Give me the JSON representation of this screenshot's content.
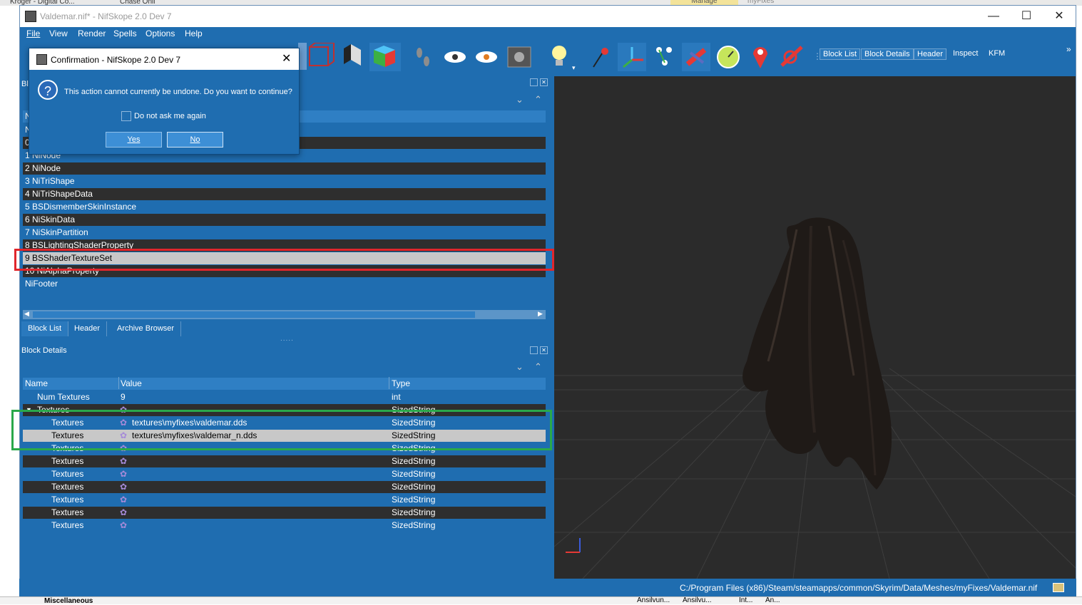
{
  "desktop": {
    "top_items": [
      "Kroger - Digital Co...",
      "Chase Onli",
      "Manage",
      "myFixes"
    ],
    "bottom_items": [
      "Miscellaneous",
      "Ansilvun...",
      "Ansilvu...",
      "Int...",
      "An..."
    ]
  },
  "window": {
    "title": "Valdemar.nif* - NifSkope 2.0 Dev 7",
    "minimize": "—",
    "maximize": "☐",
    "close": "✕"
  },
  "menu": [
    "File",
    "View",
    "Render",
    "Spells",
    "Options",
    "Help"
  ],
  "toolbar": {
    "tabs": [
      "Block List",
      "Block Details",
      "Header",
      "Inspect",
      "KFM"
    ],
    "overflow": "»"
  },
  "dialog": {
    "title": "Confirmation - NifSkope 2.0 Dev 7",
    "message": "This action cannot currently be undone. Do you want to continue?",
    "checkbox_label": "Do not ask me again",
    "yes": "Yes",
    "no": "No",
    "icon": "?"
  },
  "block_list": {
    "title": "Bl",
    "header_stub": "N",
    "rows": [
      {
        "label": "N",
        "style": "blue"
      },
      {
        "label": "0",
        "style": "dark"
      },
      {
        "label": "1 NiNode",
        "style": "blue"
      },
      {
        "label": "2 NiNode",
        "style": "dark"
      },
      {
        "label": "3 NiTriShape",
        "style": "blue"
      },
      {
        "label": "4 NiTriShapeData",
        "style": "dark"
      },
      {
        "label": "5 BSDismemberSkinInstance",
        "style": "blue"
      },
      {
        "label": "6 NiSkinData",
        "style": "dark"
      },
      {
        "label": "7 NiSkinPartition",
        "style": "blue"
      },
      {
        "label": "8 BSLightingShaderProperty",
        "style": "dark"
      },
      {
        "label": "9 BSShaderTextureSet",
        "style": "sel"
      },
      {
        "label": "10 NiAlphaProperty",
        "style": "dark"
      },
      {
        "label": "NiFooter",
        "style": "blue"
      }
    ],
    "bottom_tabs": [
      "Block List",
      "Header",
      "Archive Browser"
    ]
  },
  "block_details": {
    "title": "Block Details",
    "columns": [
      "Name",
      "Value",
      "Type"
    ],
    "rows": [
      {
        "name": "Num Textures",
        "value": "9",
        "type": "int",
        "style": "blue",
        "indent": 1
      },
      {
        "name": "Textures",
        "value": "",
        "type": "SizedString",
        "style": "dark",
        "indent": 1
      },
      {
        "name": "Textures",
        "value": "textures\\myfixes\\valdemar.dds",
        "type": "SizedString",
        "style": "blue",
        "indent": 2
      },
      {
        "name": "Textures",
        "value": "textures\\myfixes\\valdemar_n.dds",
        "type": "SizedString",
        "style": "sel",
        "indent": 2
      },
      {
        "name": "Textures",
        "value": "",
        "type": "SizedString",
        "style": "blue",
        "indent": 2
      },
      {
        "name": "Textures",
        "value": "",
        "type": "SizedString",
        "style": "dark",
        "indent": 2
      },
      {
        "name": "Textures",
        "value": "",
        "type": "SizedString",
        "style": "blue",
        "indent": 2
      },
      {
        "name": "Textures",
        "value": "",
        "type": "SizedString",
        "style": "dark",
        "indent": 2
      },
      {
        "name": "Textures",
        "value": "",
        "type": "SizedString",
        "style": "blue",
        "indent": 2
      },
      {
        "name": "Textures",
        "value": "",
        "type": "SizedString",
        "style": "dark",
        "indent": 2
      },
      {
        "name": "Textures",
        "value": "",
        "type": "SizedString",
        "style": "blue",
        "indent": 2
      }
    ]
  },
  "status": {
    "path": "C:/Program Files (x86)/Steam/steamapps/common/Skyrim/Data/Meshes/myFixes/Valdemar.nif"
  },
  "colors": {
    "ui_blue": "#1f6db0",
    "row_dark": "#2e2e2e",
    "selection": "#c8c8c8",
    "highlight_red": "#e0262c",
    "highlight_green": "#2aa84a",
    "viewport": "#2b2b2b"
  }
}
